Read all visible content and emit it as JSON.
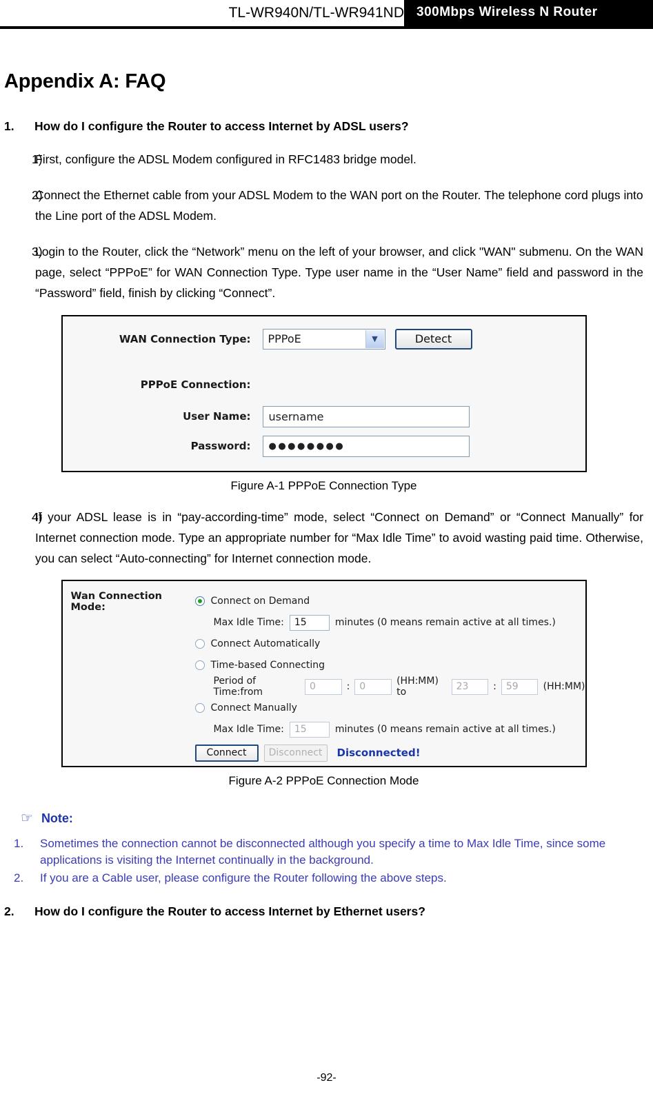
{
  "header": {
    "model": "TL-WR940N/TL-WR941ND",
    "tagline": "300Mbps Wireless N Router"
  },
  "appendix_title": "Appendix A: FAQ",
  "faqs": [
    {
      "number": "1.",
      "question": "How do I configure the Router to access Internet by ADSL users?",
      "steps": [
        {
          "number": "1)",
          "text": "First, configure the ADSL Modem configured in RFC1483 bridge model."
        },
        {
          "number": "2)",
          "text": "Connect the Ethernet cable from your ADSL Modem to the WAN port on the Router. The telephone cord plugs into the Line port of the ADSL Modem."
        },
        {
          "number": "3)",
          "text": "Login to the Router, click the “Network” menu on the left of your browser, and click \"WAN\" submenu. On the WAN page, select “PPPoE” for WAN Connection Type. Type user name in the “User Name” field and password in the “Password” field, finish by clicking “Connect”."
        },
        {
          "number": "4)",
          "text": "If your ADSL lease is in “pay-according-time” mode, select “Connect on Demand” or “Connect Manually” for Internet connection mode. Type an appropriate number for “Max Idle Time” to avoid wasting paid time. Otherwise, you can select “Auto-connecting” for Internet connection mode."
        }
      ]
    },
    {
      "number": "2.",
      "question": "How do I configure the Router to access Internet by Ethernet users?",
      "steps": []
    }
  ],
  "figure_a1": {
    "caption": "Figure A-1 PPPoE Connection Type",
    "wan_connection_type_label": "WAN Connection Type:",
    "wan_connection_type_value": "PPPoE",
    "wan_connection_type_options": [
      "PPPoE"
    ],
    "detect_button": "Detect",
    "pppoe_connection_label": "PPPoE Connection:",
    "user_name_label": "User Name:",
    "user_name_value": "username",
    "password_label": "Password:",
    "password_value": "●●●●●●●●",
    "dropdown_icon": "chevron-down-icon"
  },
  "figure_a2": {
    "caption": "Figure A-2 PPPoE Connection Mode",
    "mode_label": "Wan Connection Mode:",
    "opt_connect_on_demand": "Connect on Demand",
    "max_idle_time_label_1": "Max Idle Time:",
    "max_idle_time_value_1": "15",
    "max_idle_time_hint_1": "minutes (0 means remain active at all times.)",
    "opt_connect_automatically": "Connect Automatically",
    "opt_time_based_connecting": "Time-based Connecting",
    "period_label": "Period of Time:from",
    "period_from_hh": "0",
    "period_from_mm": "0",
    "period_unit_from": "(HH:MM) to",
    "period_to_hh": "23",
    "period_to_mm": "59",
    "period_unit_to": "(HH:MM)",
    "colon": ":",
    "opt_connect_manually": "Connect Manually",
    "max_idle_time_label_2": "Max Idle Time:",
    "max_idle_time_value_2": "15",
    "max_idle_time_hint_2": "minutes (0 means remain active at all times.)",
    "connect_button": "Connect",
    "disconnect_button": "Disconnect",
    "status": "Disconnected!",
    "status_color": "#1c35a8",
    "selected_radio_color": "#1ea01e"
  },
  "note": {
    "hand_icon": "☞",
    "title": "Note:",
    "color": "#3b3bb5",
    "items": [
      {
        "number": "1.",
        "text": "Sometimes the connection cannot be disconnected although you specify a time to Max Idle Time, since some applications is visiting the Internet continually in the background."
      },
      {
        "number": "2.",
        "text": "If you are a Cable user, please configure the Router following the above steps."
      }
    ]
  },
  "footer": {
    "page_number": "-92-"
  }
}
